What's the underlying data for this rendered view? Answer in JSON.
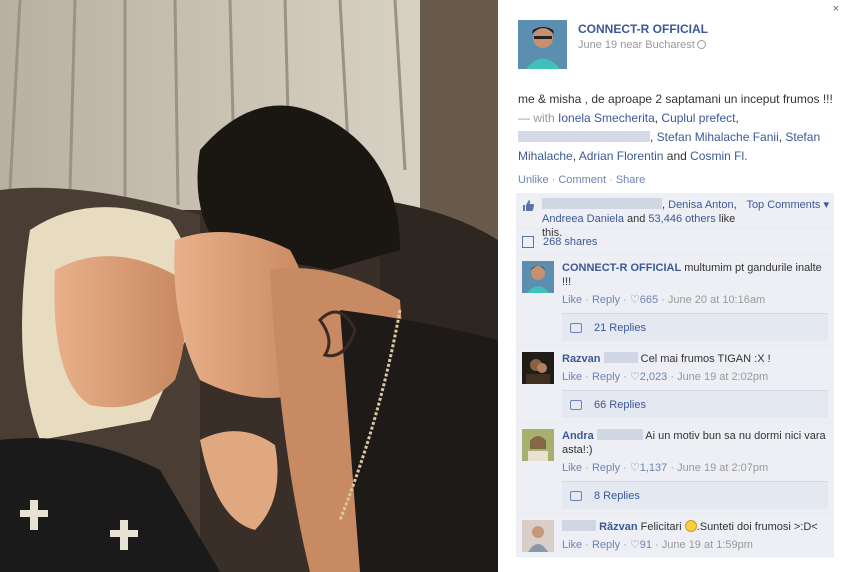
{
  "panel": {
    "close_icon": "×",
    "author": {
      "name": "CONNECT-R OFFICIAL",
      "meta": "June 19 near Bucharest"
    },
    "post": {
      "text_main": "me & misha , de aproape 2 saptamani un inceput frumos !!!",
      "with_sep": " — with ",
      "tags": [
        "Ionela Smecherita",
        "Cuplul prefect",
        "Stefan Mihalache Fanii",
        "Stefan Mihalache",
        "Adrian Florentin",
        "Cosmin Fl."
      ],
      "comma": ", ",
      "and_word": " and "
    },
    "actions": {
      "unlike": "Unlike",
      "comment": "Comment",
      "share": "Share",
      "sep": " · "
    },
    "likes": {
      "name1": "Denisa Anton",
      "name2": "Andreea Daniela",
      "others": "53,446 others",
      "suffix": " like this.",
      "and_word": " and ",
      "top_comments": "Top Comments ▾"
    },
    "shares": {
      "label": "268 shares"
    },
    "comments": [
      {
        "name": "CONNECT-R OFFICIAL",
        "text": "multumim pt gandurile inalte !!!",
        "like": "Like",
        "reply": "Reply",
        "count": "665",
        "time": "June 20 at 10:16am",
        "replies": "21 Replies"
      },
      {
        "name": "Razvan",
        "text": "Cel mai frumos TIGAN :X !",
        "like": "Like",
        "reply": "Reply",
        "count": "2,023",
        "time": "June 19 at 2:02pm",
        "replies": "66 Replies"
      },
      {
        "name": "Andra",
        "text": "Ai un motiv bun sa nu dormi nici vara asta!:)",
        "like": "Like",
        "reply": "Reply",
        "count": "1,137",
        "time": "June 19 at 2:07pm",
        "replies": "8 Replies"
      },
      {
        "name": "Răzvan",
        "text_before": "Felicitari ",
        "text_after": ".Sunteti doi frumosi >:D<",
        "like": "Like",
        "reply": "Reply",
        "count": "91",
        "time": "June 19 at 1:59pm"
      }
    ],
    "meta_sep": " · ",
    "like_icon": "👍"
  }
}
